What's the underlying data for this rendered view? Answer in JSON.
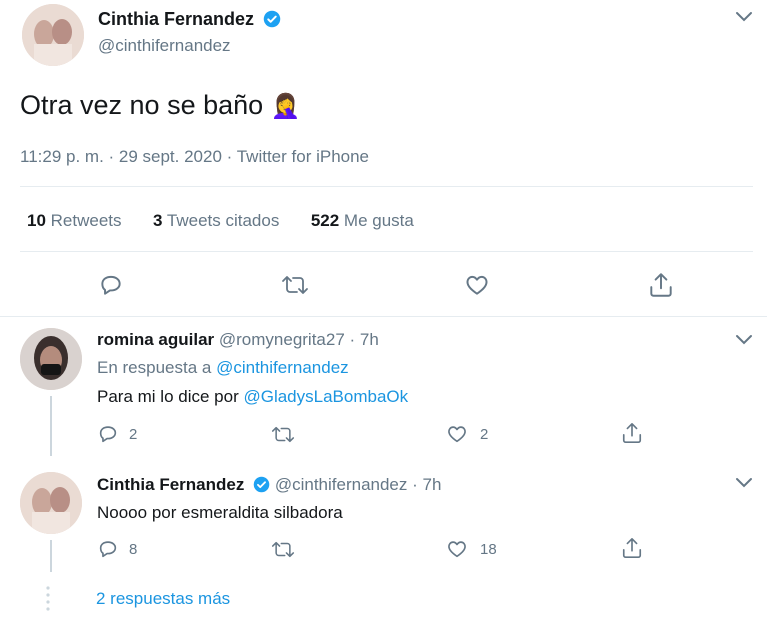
{
  "main_tweet": {
    "author_name": "Cinthia Fernandez",
    "author_handle": "@cinthifernandez",
    "text": "Otra vez no se baño",
    "emoji": "🤦‍♀️",
    "meta": "11:29 p. m. · 29 sept. 2020 · Twitter for iPhone",
    "stats": {
      "retweets_count": "10",
      "retweets_label": "Retweets",
      "quotes_count": "3",
      "quotes_label": "Tweets citados",
      "likes_count": "522",
      "likes_label": "Me gusta"
    }
  },
  "replies": [
    {
      "author_name": "romina aguilar",
      "author_handle": "@romynegrita27",
      "time": "· 7h",
      "in_reply_prefix": "En respuesta a",
      "in_reply_handle": "@cinthifernandez",
      "text_prefix": "Para mi lo dice por",
      "text_mention": "@GladysLaBombaOk",
      "reply_count": "2",
      "like_count": "2"
    },
    {
      "author_name": "Cinthia Fernandez",
      "author_handle": "@cinthifernandez",
      "time": "· 7h",
      "text": "Noooo por esmeraldita silbadora",
      "reply_count": "8",
      "like_count": "18"
    }
  ],
  "more_replies_label": "2 respuestas más",
  "colors": {
    "link": "#1b95e0",
    "verified": "#1da1f2",
    "muted": "#657786",
    "divider": "#e6ecf0"
  }
}
